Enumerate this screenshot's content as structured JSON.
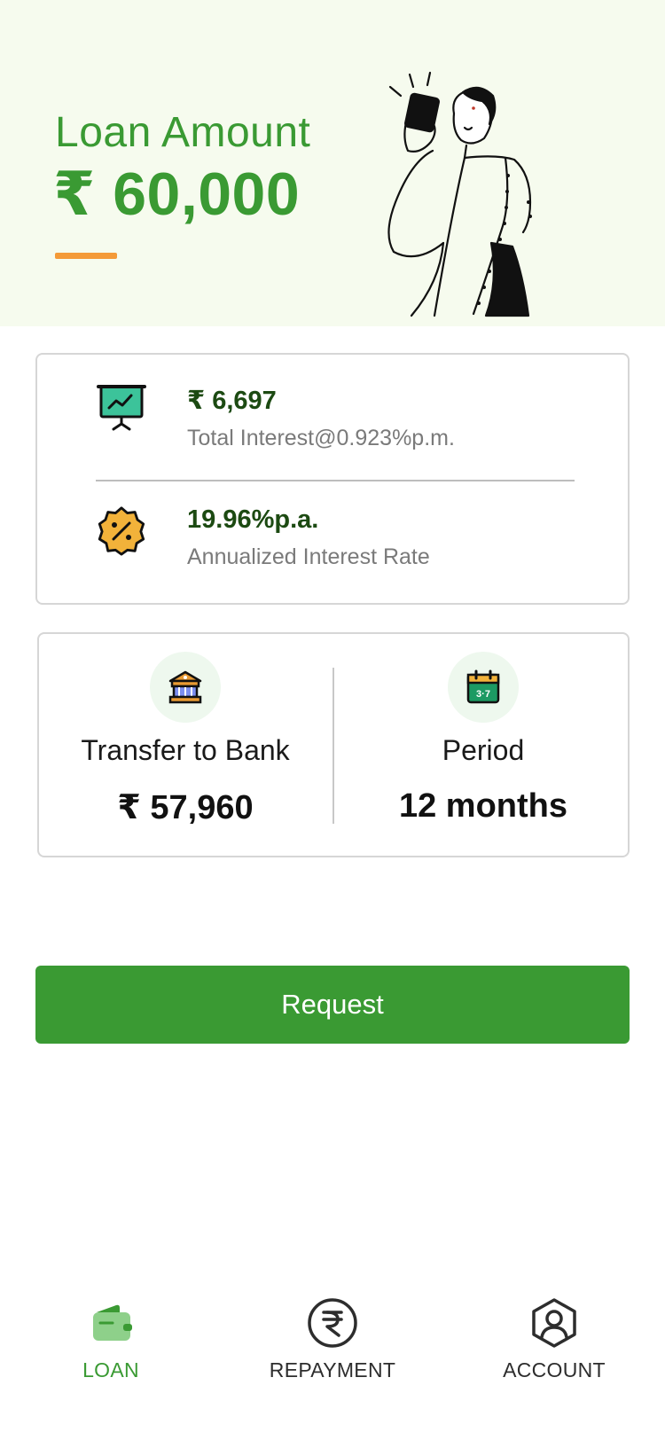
{
  "hero": {
    "label": "Loan Amount",
    "amount": "₹ 60,000"
  },
  "interest_card": {
    "total_interest_value": "₹ 6,697",
    "total_interest_caption": "Total Interest@0.923%p.m.",
    "annual_rate_value": "19.96%p.a.",
    "annual_rate_caption": "Annualized Interest Rate"
  },
  "transfer_card": {
    "transfer_title": "Transfer to Bank",
    "transfer_value": "₹ 57,960",
    "period_title": "Period",
    "period_value": "12 months",
    "calendar_icon_text": "3·7"
  },
  "actions": {
    "request_label": "Request"
  },
  "bottom_nav": {
    "items": [
      {
        "label": "LOAN",
        "icon": "wallet-icon",
        "active": true
      },
      {
        "label": "REPAYMENT",
        "icon": "rupee-icon",
        "active": false
      },
      {
        "label": "ACCOUNT",
        "icon": "user-icon",
        "active": false
      }
    ]
  },
  "colors": {
    "brand_green": "#3a9a33",
    "hero_bg": "#f6fbee",
    "accent_orange": "#f49a38",
    "dark_green_text": "#1c4a12"
  }
}
